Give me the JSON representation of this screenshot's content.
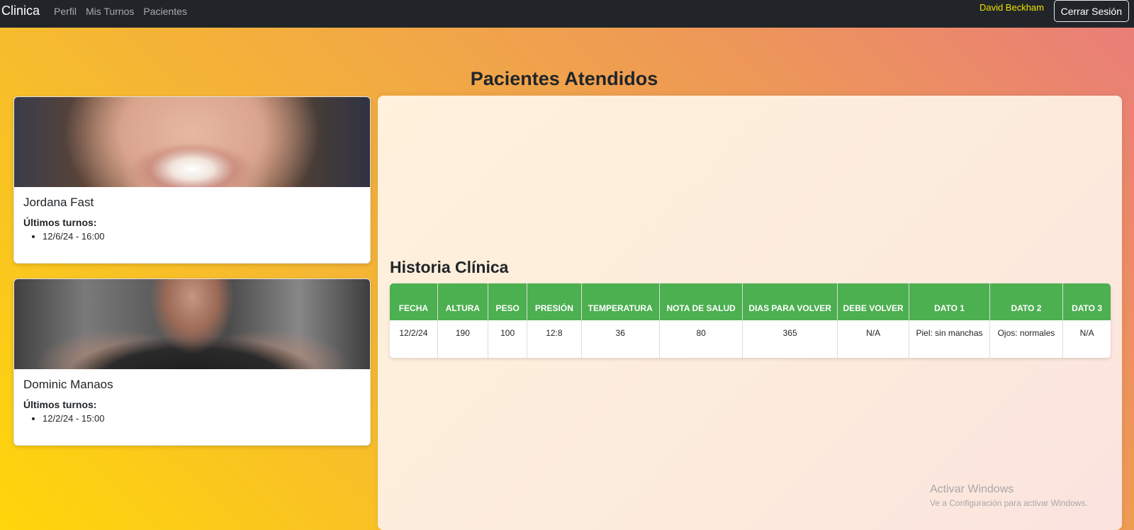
{
  "navbar": {
    "brand": "Clinica",
    "links": [
      "Perfil",
      "Mis Turnos",
      "Pacientes"
    ],
    "user_name": "David Beckham",
    "logout_label": "Cerrar Sesión"
  },
  "page_title": "Pacientes Atendidos",
  "patients": [
    {
      "name": "Jordana Fast",
      "turns_label": "Últimos turnos:",
      "turns": [
        "12/6/24 - 16:00"
      ]
    },
    {
      "name": "Dominic Manaos",
      "turns_label": "Últimos turnos:",
      "turns": [
        "12/2/24 - 15:00"
      ]
    }
  ],
  "history": {
    "title": "Historia Clínica",
    "columns": [
      "FECHA",
      "ALTURA",
      "PESO",
      "PRESIÓN",
      "TEMPERATURA",
      "NOTA DE SALUD",
      "DIAS PARA VOLVER",
      "DEBE VOLVER",
      "DATO 1",
      "DATO 2",
      "DATO 3"
    ],
    "rows": [
      [
        "12/2/24",
        "190",
        "100",
        "12:8",
        "36",
        "80",
        "365",
        "N/A",
        "Piel: sin manchas",
        "Ojos: normales",
        "N/A"
      ]
    ]
  },
  "watermark": {
    "title": "Activar Windows",
    "subtitle": "Ve a Configuración para activar Windows."
  },
  "colors": {
    "navbar_bg": "#212529",
    "user_name": "#f0e100",
    "table_header": "#4caf50"
  }
}
